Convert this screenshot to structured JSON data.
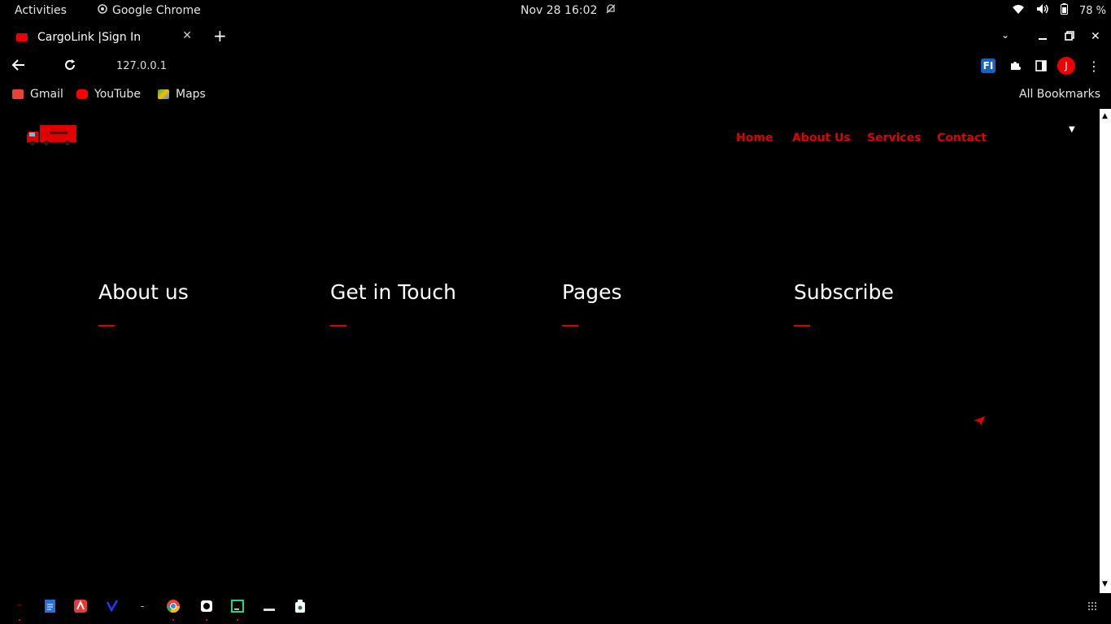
{
  "topbar": {
    "activities": "Activities",
    "app_name": "Google Chrome",
    "datetime": "Nov 28  16:02",
    "battery": "78 %"
  },
  "browser": {
    "tab_title": "CargoLink |Sign In",
    "url": "127.0.0.1",
    "profile_initial": "J",
    "ext_label": "FI",
    "bookmarks": [
      {
        "label": "Gmail",
        "color": "#ea4335"
      },
      {
        "label": "YouTube",
        "color": "#ff0000"
      },
      {
        "label": "Maps",
        "color": "#34a853"
      }
    ],
    "all_bookmarks": "All Bookmarks"
  },
  "site": {
    "accent": "#e00000",
    "nav": [
      "Home",
      "About Us",
      "Services",
      "Contact"
    ],
    "footer_columns": [
      "About us",
      "Get in Touch",
      "Pages",
      "Subscribe"
    ]
  }
}
